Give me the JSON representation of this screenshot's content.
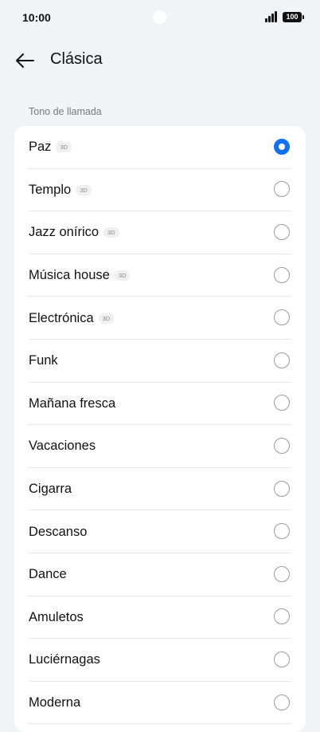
{
  "status_bar": {
    "time": "10:00",
    "battery": "100"
  },
  "header": {
    "title": "Clásica",
    "back_icon": "arrow-left-icon"
  },
  "section": {
    "label": "Tono de llamada"
  },
  "accent_color": "#1470ef",
  "ringtones": [
    {
      "name": "Paz",
      "badge": "3D",
      "selected": true
    },
    {
      "name": "Templo",
      "badge": "3D",
      "selected": false
    },
    {
      "name": "Jazz onírico",
      "badge": "3D",
      "selected": false
    },
    {
      "name": "Música house",
      "badge": "3D",
      "selected": false
    },
    {
      "name": "Electrónica",
      "badge": "3D",
      "selected": false
    },
    {
      "name": "Funk",
      "badge": "",
      "selected": false
    },
    {
      "name": "Mañana fresca",
      "badge": "",
      "selected": false
    },
    {
      "name": "Vacaciones",
      "badge": "",
      "selected": false
    },
    {
      "name": "Cigarra",
      "badge": "",
      "selected": false
    },
    {
      "name": "Descanso",
      "badge": "",
      "selected": false
    },
    {
      "name": "Dance",
      "badge": "",
      "selected": false
    },
    {
      "name": "Amuletos",
      "badge": "",
      "selected": false
    },
    {
      "name": "Luciérnagas",
      "badge": "",
      "selected": false
    },
    {
      "name": "Moderna",
      "badge": "",
      "selected": false
    }
  ]
}
